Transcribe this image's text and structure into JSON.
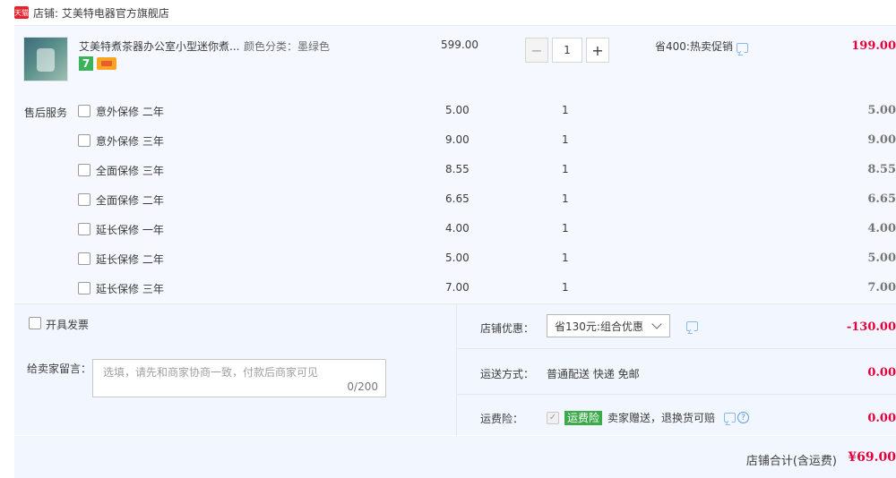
{
  "shop": {
    "logo_text": "天猫",
    "name": "店铺: 艾美特电器官方旗舰店"
  },
  "product": {
    "title": "艾美特煮茶器办公室小型迷你煮...",
    "sku": "颜色分类：墨绿色",
    "badge": "7",
    "price": "599.00",
    "quantity": "1",
    "minus_label": "−",
    "plus_label": "+",
    "promo": "省400:热卖促销",
    "total": "199.00"
  },
  "after_sales": {
    "label": "售后服务",
    "items": [
      {
        "name": "意外保修 二年",
        "price": "5.00",
        "qty": "1",
        "total": "5.00"
      },
      {
        "name": "意外保修 三年",
        "price": "9.00",
        "qty": "1",
        "total": "9.00"
      },
      {
        "name": "全面保修 三年",
        "price": "8.55",
        "qty": "1",
        "total": "8.55"
      },
      {
        "name": "全面保修 二年",
        "price": "6.65",
        "qty": "1",
        "total": "6.65"
      },
      {
        "name": "延长保修 一年",
        "price": "4.00",
        "qty": "1",
        "total": "4.00"
      },
      {
        "name": "延长保修 二年",
        "price": "5.00",
        "qty": "1",
        "total": "5.00"
      },
      {
        "name": "延长保修 三年",
        "price": "7.00",
        "qty": "1",
        "total": "7.00"
      }
    ]
  },
  "invoice": {
    "label": "开具发票"
  },
  "message": {
    "label": "给卖家留言：",
    "placeholder": "选填，请先和商家协商一致，付款后商家可见",
    "count": "0/200"
  },
  "discount": {
    "label": "店铺优惠：",
    "selected": "省130元:组合优惠",
    "amount": "-130.00"
  },
  "shipping": {
    "label": "运送方式：",
    "value": "普通配送 快递 免邮",
    "amount": "0.00"
  },
  "insurance": {
    "label": "运费险：",
    "badge": "运费险",
    "value": "卖家赠送，退换货可赔",
    "help": "?",
    "amount": "0.00"
  },
  "footer": {
    "label": "店铺合计(含运费)",
    "amount": "¥69.00"
  }
}
